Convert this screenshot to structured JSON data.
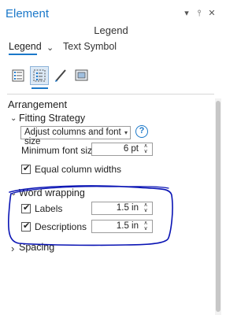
{
  "panel": {
    "title": "Element",
    "controls": {
      "chevron": "▾",
      "pin": "⫯",
      "close": "✕"
    },
    "subtitle": "Legend"
  },
  "tabs": [
    {
      "label": "Legend",
      "active": true
    },
    {
      "label": "Text Symbol",
      "active": false
    }
  ],
  "tab_chevron": "⌄",
  "icons": [
    "legend-options-icon",
    "legend-arrangement-icon",
    "pen-icon",
    "display-icon"
  ],
  "section_title": "Arrangement",
  "fitting_strategy": {
    "label": "Fitting Strategy",
    "dropdown_value": "Adjust columns and font size",
    "help": "?",
    "min_font_label": "Minimum font size",
    "min_font_value": "6 pt",
    "equal_widths_label": "Equal column widths",
    "equal_widths_checked": true
  },
  "word_wrapping": {
    "label": "Word wrapping",
    "labels_label": "Labels",
    "labels_value": "1.5 in",
    "labels_checked": true,
    "descriptions_label": "Descriptions",
    "descriptions_value": "1.5 in",
    "descriptions_checked": true
  },
  "spacing": {
    "label": "Spacing"
  },
  "glyphs": {
    "expanded": "⌄",
    "collapsed": "›",
    "check": "✔",
    "up": "∧",
    "down": "∨",
    "dd": "▾"
  },
  "annotation_color": "#0a14b4"
}
